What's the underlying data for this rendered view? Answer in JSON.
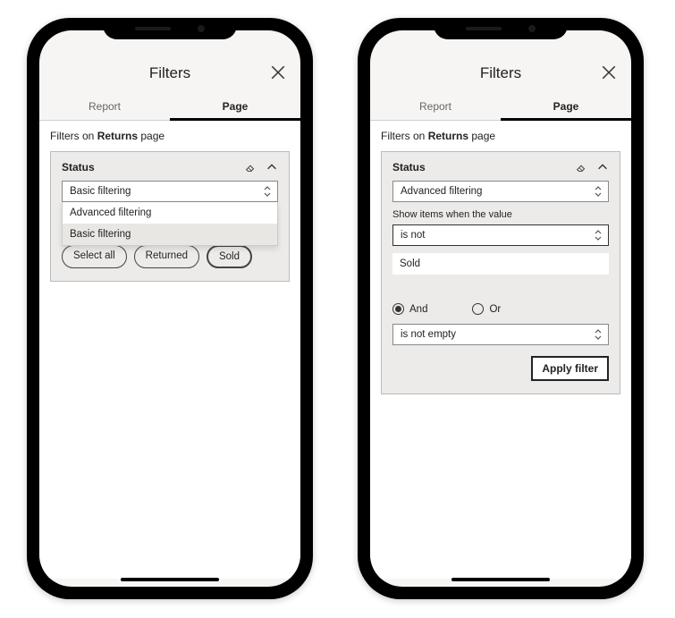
{
  "header": {
    "title": "Filters"
  },
  "tabs": {
    "report": "Report",
    "page": "Page"
  },
  "filters_on_prefix": "Filters on ",
  "filters_on_page": "Returns",
  "filters_on_suffix": " page",
  "left": {
    "card_title": "Status",
    "select_value": "Basic filtering",
    "dropdown": {
      "opt1": "Advanced filtering",
      "opt2": "Basic filtering"
    },
    "chips": {
      "select_all": "Select all",
      "returned": "Returned",
      "sold": "Sold"
    }
  },
  "right": {
    "card_title": "Status",
    "select_value": "Advanced filtering",
    "show_items_label": "Show items when the value",
    "condition1": "is not",
    "value1": "Sold",
    "logic": {
      "and": "And",
      "or": "Or"
    },
    "condition2": "is not empty",
    "apply_label": "Apply filter"
  }
}
